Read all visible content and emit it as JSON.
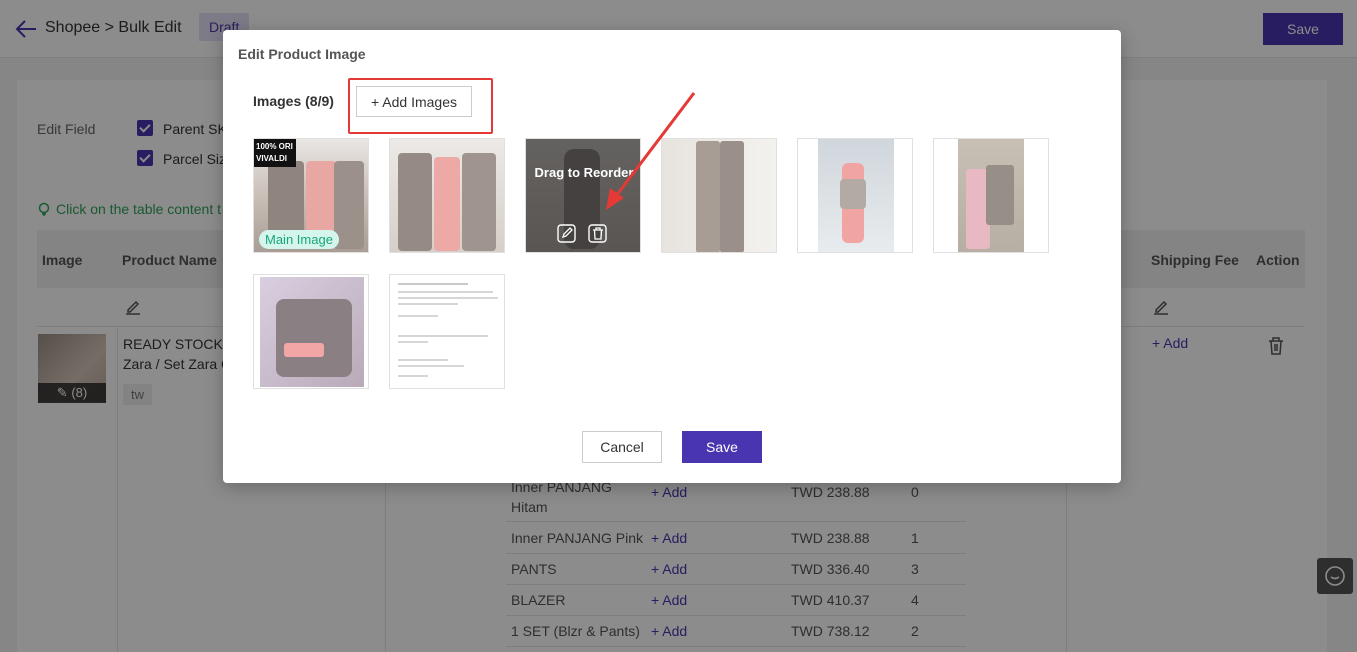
{
  "header": {
    "breadcrumb": "Shopee > Bulk Edit",
    "draft_label": "Draft",
    "save_label": "Save"
  },
  "background": {
    "edit_field_label": "Edit Field",
    "fields": [
      "Parent SKU",
      "Parcel Size"
    ],
    "hint": "Click on the table content t",
    "columns": [
      "Image",
      "Product Name",
      "Shipping Fee",
      "Action"
    ],
    "product": {
      "image_count": "(8)",
      "name": "READY STOCK ! Zara / Set Zara Co",
      "tag": "tw",
      "shipping_add": "+ Add"
    },
    "variants": [
      {
        "name": "Inner PANJANG Hitam",
        "add": "+ Add",
        "price": "TWD 238.88",
        "stock": "0"
      },
      {
        "name": "Inner PANJANG Pink",
        "add": "+ Add",
        "price": "TWD 238.88",
        "stock": "1"
      },
      {
        "name": "PANTS",
        "add": "+ Add",
        "price": "TWD 336.40",
        "stock": "3"
      },
      {
        "name": "BLAZER",
        "add": "+ Add",
        "price": "TWD 410.37",
        "stock": "4"
      },
      {
        "name": "1 SET (Blzr & Pants)",
        "add": "+ Add",
        "price": "TWD 738.12",
        "stock": "2"
      }
    ]
  },
  "modal": {
    "title": "Edit Product Image",
    "images_label": "Images (8/9)",
    "add_images_label": "+ Add Images",
    "main_image_tag": "Main Image",
    "drag_to_reorder": "Drag to Reorder",
    "cancel_label": "Cancel",
    "save_label": "Save",
    "image_count": 8,
    "image_badge_1": "100% ORI",
    "image_badge_2": "VIVALDI"
  },
  "colors": {
    "accent": "#4a35b0",
    "annotation_red": "#e53935",
    "main_tag_bg": "#d4f5ec",
    "main_tag_text": "#19a57c"
  }
}
